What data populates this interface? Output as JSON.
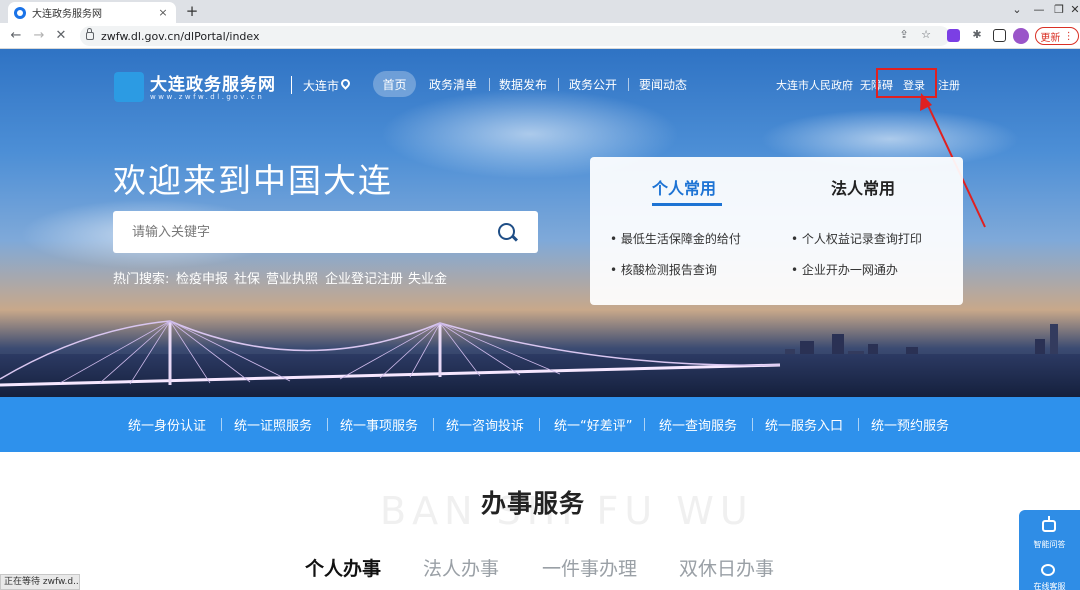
{
  "browser": {
    "tab_title": "大连政务服务网",
    "tab_close": "×",
    "new_tab": "+",
    "url": "zwfw.dl.gov.cn/dlPortal/index",
    "update_label": "更新",
    "status_text": "正在等待 zwfw.d..."
  },
  "site": {
    "logo_title": "大连政务服务网",
    "logo_sub": "www.zwfw.dl.gov.cn",
    "city": "大连市",
    "nav": [
      "首页",
      "政务清单",
      "数据发布",
      "政务公开",
      "要闻动态"
    ],
    "top_links": {
      "gov": "大连市人民政府",
      "accessible": "无障碍",
      "login": "登录",
      "register": "注册"
    }
  },
  "hero": {
    "welcome": "欢迎来到中国大连",
    "search_placeholder": "请输入关键字",
    "hot_label": "热门搜索:",
    "hot_items": [
      "检疫申报",
      "社保",
      "营业执照",
      "企业登记注册",
      "失业金"
    ]
  },
  "panel": {
    "tab_personal": "个人常用",
    "tab_legal": "法人常用",
    "links": [
      "最低生活保障金的给付",
      "个人权益记录查询打印",
      "核酸检测报告查询",
      "企业开办一网通办"
    ]
  },
  "service_bar": [
    "统一身份认证",
    "统一证照服务",
    "统一事项服务",
    "统一咨询投诉",
    "统一“好差评”",
    "统一查询服务",
    "统一服务入口",
    "统一预约服务"
  ],
  "section": {
    "watermark": "BAN SHI FU WU",
    "title": "办事服务",
    "tabs": [
      "个人办事",
      "法人办事",
      "一件事办理",
      "双休日办事"
    ]
  },
  "float": {
    "assistant": "智能问答",
    "chat": "在线客服"
  },
  "colors": {
    "primary_blue": "#2e91ec",
    "highlight_red": "#e02020",
    "panel_active": "#1d73d4"
  }
}
